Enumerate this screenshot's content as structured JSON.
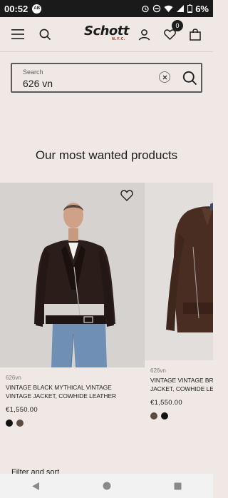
{
  "status_bar": {
    "time": "00:52",
    "notif_badge": "AB",
    "battery": "6%"
  },
  "header": {
    "logo_text": "Schott",
    "logo_sub": "N.Y.C.",
    "wishlist_count": "0"
  },
  "search": {
    "label": "Search",
    "value": "626 vn"
  },
  "section": {
    "title": "Our most wanted products"
  },
  "products": [
    {
      "brand": "626vn",
      "name_line1": "VINTAGE BLACK MYTHICAL VINTAGE",
      "name_line2": "VINTAGE JACKET, COWHIDE LEATHER",
      "price": "€1,550.00",
      "swatches": [
        "#111111",
        "#5b4a3e"
      ]
    },
    {
      "brand": "626vn",
      "name_line1": "VINTAGE VINTAGE BR",
      "name_line2": "JACKET, COWHIDE LE",
      "price": "€1,550.00",
      "swatches": [
        "#5b4a3e",
        "#111111"
      ]
    }
  ],
  "filter_peek": "Filter and sort",
  "colors": {
    "background": "#efe8e4",
    "text": "#1d1d1d",
    "status_bar": "#1a1a1a"
  }
}
